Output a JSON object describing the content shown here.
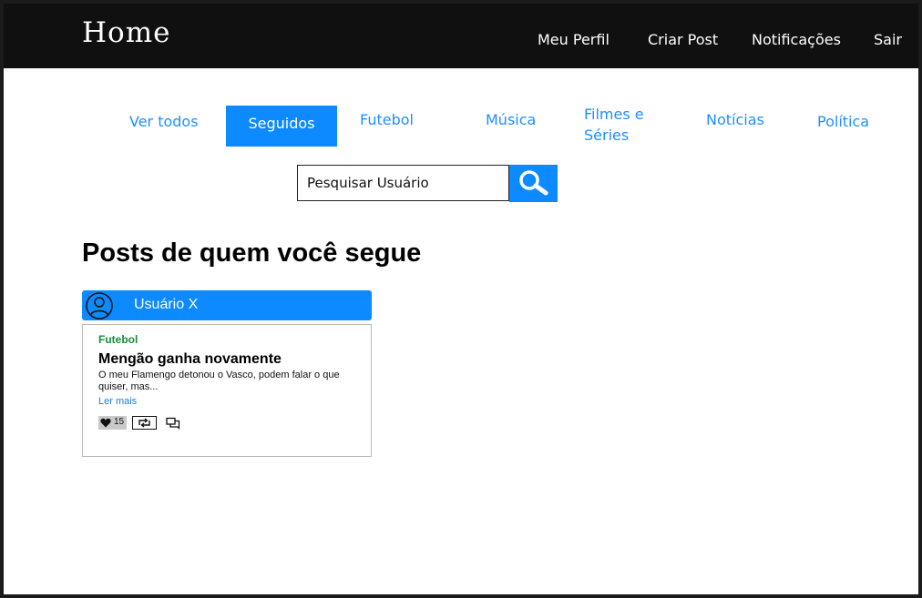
{
  "header": {
    "title": "Home",
    "nav": [
      "Meu Perfil",
      "Criar Post",
      "Notificações",
      "Sair"
    ]
  },
  "tabs": [
    {
      "label": "Ver todos",
      "active": false
    },
    {
      "label": "Seguidos",
      "active": true
    },
    {
      "label": "Futebol",
      "active": false
    },
    {
      "label": "Música",
      "active": false
    },
    {
      "label": "Filmes e Séries",
      "active": false
    },
    {
      "label": "Notícias",
      "active": false
    },
    {
      "label": "Política",
      "active": false
    }
  ],
  "search": {
    "placeholder": "Pesquisar Usuário",
    "icon": "search-icon"
  },
  "section": {
    "title": "Posts de quem você segue"
  },
  "post": {
    "username": "Usuário X",
    "category": "Futebol",
    "title": "Mengão ganha novamente",
    "excerpt": "O meu Flamengo detonou o Vasco, podem falar o que quiser, mas...",
    "read_more": "Ler mais",
    "likes": "15"
  },
  "colors": {
    "accent": "#0d8aff",
    "topbar": "#101010",
    "category": "#1a8a3a"
  }
}
